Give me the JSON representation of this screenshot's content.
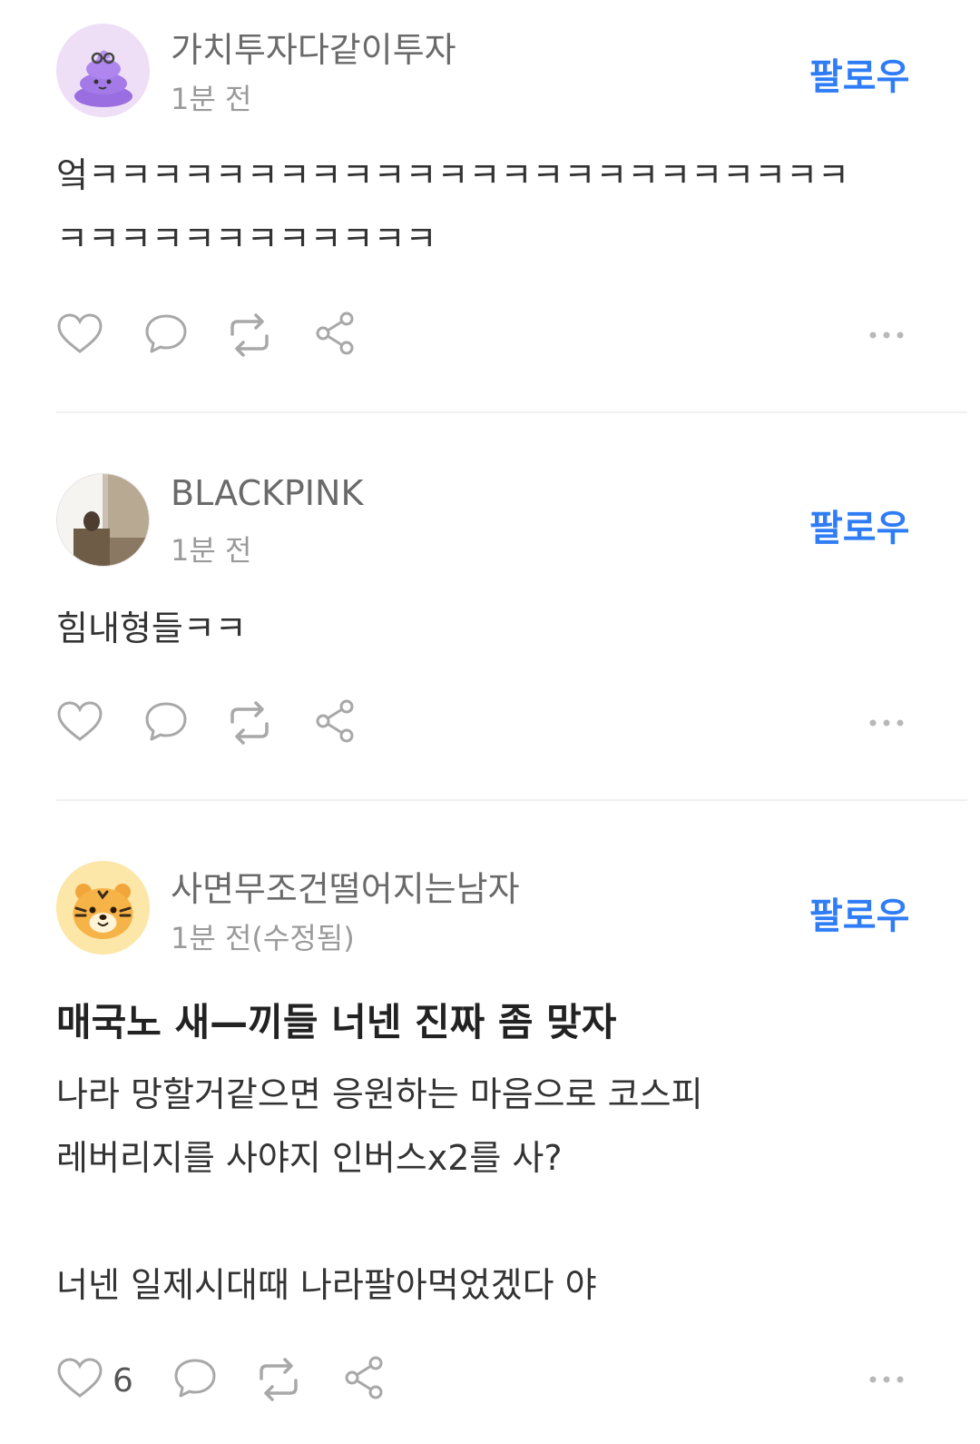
{
  "posts": [
    {
      "username": "가치투자다같이투자",
      "time": "1분 전",
      "follow_label": "팔로우",
      "body_lines": [
        "엌ㅋㅋㅋㅋㅋㅋㅋㅋㅋㅋㅋㅋㅋㅋㅋㅋㅋㅋㅋㅋㅋㅋㅋㅋ",
        "ㅋㅋㅋㅋㅋㅋㅋㅋㅋㅋㅋㅋ"
      ],
      "avatar_icon": "purple-poop-emoji-icon"
    },
    {
      "username": "BLACKPINK",
      "time": "1분 전",
      "follow_label": "팔로우",
      "body_lines": [
        "힘내형들ㅋㅋ"
      ],
      "avatar_icon": "photo-avatar"
    },
    {
      "username": "사면무조건떨어지는남자",
      "time": "1분 전(수정됨)",
      "follow_label": "팔로우",
      "title": "매국노 새—끼들 너넨 진짜 좀 맞자",
      "body_lines": [
        "나라 망할거같으면 응원하는 마음으로 코스피",
        "레버리지를 사야지 인버스x2를 사?",
        "",
        "너넨 일제시대때 나라팔아먹었겠다 야"
      ],
      "like_count": "6",
      "avatar_icon": "tiger-face-icon"
    }
  ],
  "colors": {
    "follow": "#2f7df6",
    "icon_stroke": "#a8a8a8",
    "divider": "#f0f0f0"
  },
  "icons": [
    "heart-icon",
    "comment-icon",
    "repost-icon",
    "share-icon",
    "more-icon"
  ]
}
